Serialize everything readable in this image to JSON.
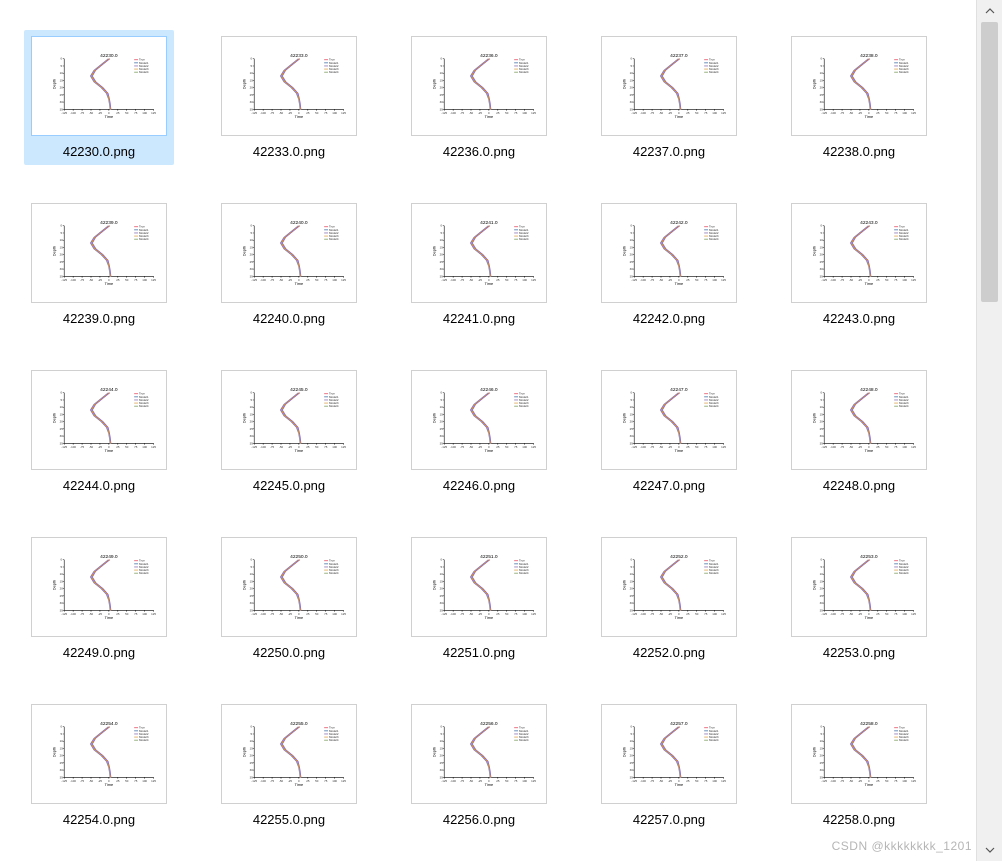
{
  "watermark": "CSDN @kkkkkkkk_1201",
  "chart_template": {
    "xlabel": "Time",
    "ylabel": "Depth",
    "xticks": [
      "-125",
      "-100",
      "-75",
      "-50",
      "-25",
      "0",
      "25",
      "50",
      "75",
      "100",
      "125"
    ],
    "yticks": [
      "0",
      "5",
      "10",
      "15",
      "20",
      "25",
      "30",
      "35"
    ],
    "legend": [
      "True",
      "Model1",
      "Model2",
      "Model3",
      "Model4"
    ]
  },
  "files": [
    {
      "name": "42230.0.png",
      "chart_title": "42230.0",
      "selected": true
    },
    {
      "name": "42233.0.png",
      "chart_title": "42233.0",
      "selected": false
    },
    {
      "name": "42236.0.png",
      "chart_title": "42236.0",
      "selected": false
    },
    {
      "name": "42237.0.png",
      "chart_title": "42237.0",
      "selected": false
    },
    {
      "name": "42238.0.png",
      "chart_title": "42238.0",
      "selected": false
    },
    {
      "name": "42239.0.png",
      "chart_title": "42239.0",
      "selected": false
    },
    {
      "name": "42240.0.png",
      "chart_title": "42240.0",
      "selected": false
    },
    {
      "name": "42241.0.png",
      "chart_title": "42241.0",
      "selected": false
    },
    {
      "name": "42242.0.png",
      "chart_title": "42242.0",
      "selected": false
    },
    {
      "name": "42243.0.png",
      "chart_title": "42243.0",
      "selected": false
    },
    {
      "name": "42244.0.png",
      "chart_title": "42244.0",
      "selected": false
    },
    {
      "name": "42245.0.png",
      "chart_title": "42245.0",
      "selected": false
    },
    {
      "name": "42246.0.png",
      "chart_title": "42246.0",
      "selected": false
    },
    {
      "name": "42247.0.png",
      "chart_title": "42247.0",
      "selected": false
    },
    {
      "name": "42248.0.png",
      "chart_title": "42248.0",
      "selected": false
    },
    {
      "name": "42249.0.png",
      "chart_title": "42249.0",
      "selected": false
    },
    {
      "name": "42250.0.png",
      "chart_title": "42250.0",
      "selected": false
    },
    {
      "name": "42251.0.png",
      "chart_title": "42251.0",
      "selected": false
    },
    {
      "name": "42252.0.png",
      "chart_title": "42252.0",
      "selected": false
    },
    {
      "name": "42253.0.png",
      "chart_title": "42253.0",
      "selected": false
    },
    {
      "name": "42254.0.png",
      "chart_title": "42254.0",
      "selected": false
    },
    {
      "name": "42255.0.png",
      "chart_title": "42255.0",
      "selected": false
    },
    {
      "name": "42256.0.png",
      "chart_title": "42256.0",
      "selected": false
    },
    {
      "name": "42257.0.png",
      "chart_title": "42257.0",
      "selected": false
    },
    {
      "name": "42258.0.png",
      "chart_title": "42258.0",
      "selected": false
    }
  ],
  "chart_data": {
    "type": "line",
    "note": "Each thumbnail is a line chart of Depth (y, inverted downward 0→35) vs Time (x, −125→125) with 4 model curves against a True curve. Shapes across files are near-identical; curves bulge left around Depth≈10.",
    "xlabel": "Time",
    "ylabel": "Depth",
    "xlim": [
      -125,
      125
    ],
    "ylim": [
      0,
      35
    ],
    "series": [
      {
        "name": "True",
        "x": [
          0,
          -20,
          -40,
          -50,
          -40,
          -20,
          -5,
          0,
          2,
          3,
          4
        ],
        "y": [
          0,
          4,
          8,
          12,
          16,
          20,
          24,
          28,
          31,
          33,
          35
        ]
      },
      {
        "name": "Model1",
        "x": [
          2,
          -18,
          -38,
          -48,
          -38,
          -18,
          -3,
          1,
          3,
          4,
          5
        ],
        "y": [
          0,
          4,
          8,
          12,
          16,
          20,
          24,
          28,
          31,
          33,
          35
        ]
      },
      {
        "name": "Model2",
        "x": [
          -2,
          -22,
          -42,
          -52,
          -42,
          -22,
          -7,
          -1,
          1,
          2,
          3
        ],
        "y": [
          0,
          4,
          8,
          12,
          16,
          20,
          24,
          28,
          31,
          33,
          35
        ]
      },
      {
        "name": "Model3",
        "x": [
          1,
          -19,
          -39,
          -49,
          -39,
          -19,
          -4,
          0,
          2,
          3,
          4
        ],
        "y": [
          0,
          4,
          8,
          12,
          16,
          20,
          24,
          28,
          31,
          33,
          35
        ]
      },
      {
        "name": "Model4",
        "x": [
          3,
          -17,
          -37,
          -46,
          -36,
          -16,
          -2,
          2,
          4,
          5,
          6
        ],
        "y": [
          0,
          4,
          8,
          12,
          16,
          20,
          24,
          28,
          31,
          33,
          35
        ]
      }
    ]
  }
}
